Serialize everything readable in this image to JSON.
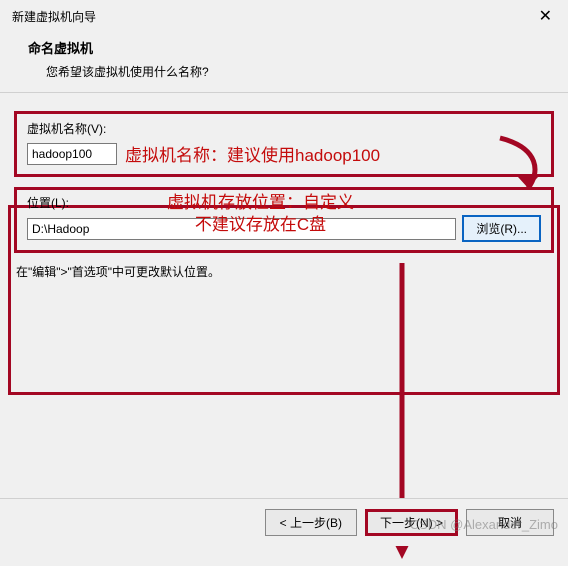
{
  "window": {
    "title": "新建虚拟机向导",
    "close_glyph": "✕"
  },
  "header": {
    "title": "命名虚拟机",
    "subtitle": "您希望该虚拟机使用什么名称?"
  },
  "vm_name": {
    "label": "虚拟机名称(V):",
    "value": "hadoop100",
    "annotation": "虚拟机名称：建议使用hadoop100"
  },
  "location": {
    "label": "位置(L):",
    "value": "D:\\Hadoop",
    "browse_label": "浏览(R)...",
    "annotation_line1": "虚拟机存放位置：自定义",
    "annotation_line2": "不建议存放在C盘"
  },
  "hint": "在\"编辑\">\"首选项\"中可更改默认位置。",
  "footer": {
    "back": "< 上一步(B)",
    "next": "下一步(N) >",
    "cancel": "取消"
  },
  "watermark": "CSDN @Alexander_Zimo"
}
